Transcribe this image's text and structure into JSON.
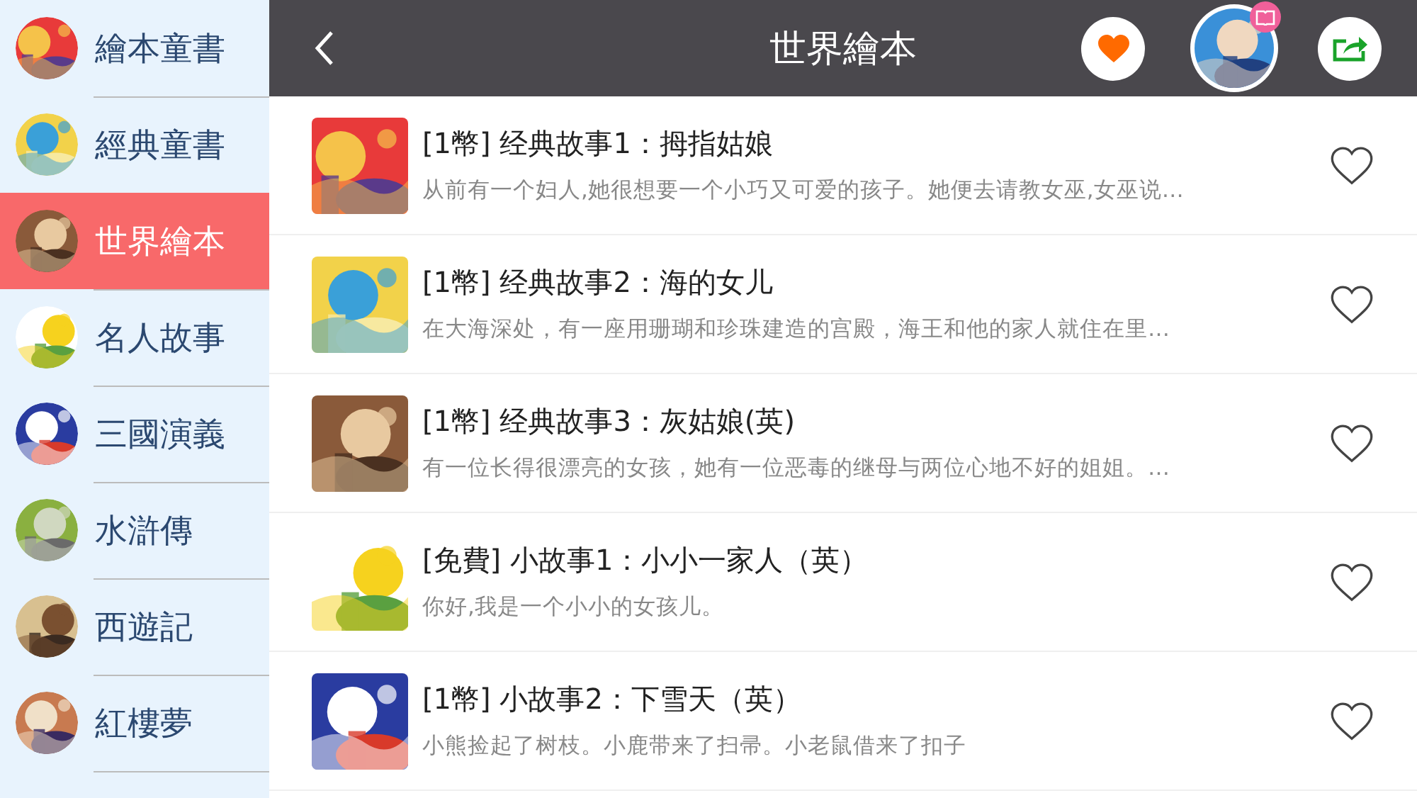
{
  "sidebar": {
    "items": [
      {
        "label": "繪本童書",
        "selected": false
      },
      {
        "label": "經典童書",
        "selected": false
      },
      {
        "label": "世界繪本",
        "selected": true
      },
      {
        "label": "名人故事",
        "selected": false
      },
      {
        "label": "三國演義",
        "selected": false
      },
      {
        "label": "水滸傳",
        "selected": false
      },
      {
        "label": "西遊記",
        "selected": false
      },
      {
        "label": "紅樓夢",
        "selected": false
      }
    ]
  },
  "header": {
    "title": "世界繪本"
  },
  "stories": [
    {
      "title": "[1幣] 经典故事1：拇指姑娘",
      "description": "从前有一个妇人,她很想要一个小巧又可爱的孩子。她便去请教女巫,女巫说…",
      "favorited": false
    },
    {
      "title": "[1幣] 经典故事2：海的女儿",
      "description": "在大海深处，有一座用珊瑚和珍珠建造的宫殿，海王和他的家人就住在里…",
      "favorited": false
    },
    {
      "title": "[1幣] 经典故事3：灰姑娘(英)",
      "description": "有一位长得很漂亮的女孩，她有一位恶毒的继母与两位心地不好的姐姐。…",
      "favorited": false
    },
    {
      "title": "[免費] 小故事1：小小一家人（英）",
      "description": "你好,我是一个小小的女孩儿。",
      "favorited": false
    },
    {
      "title": "[1幣] 小故事2：下雪天（英）",
      "description": "小熊捡起了树枝。小鹿带来了扫帚。小老鼠借来了扣子",
      "favorited": false
    }
  ]
}
